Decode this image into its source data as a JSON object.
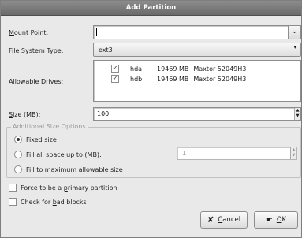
{
  "dialog": {
    "title": "Add Partition"
  },
  "mount_point": {
    "label_pre": "",
    "label_key": "M",
    "label_post": "ount Point:",
    "value": ""
  },
  "fs_type": {
    "label_pre": "File System ",
    "label_key": "T",
    "label_post": "ype:",
    "value": "ext3"
  },
  "drives": {
    "label": "Allowable Drives:",
    "items": [
      {
        "checked": true,
        "name": "hda",
        "size": "19469 MB",
        "model": "Maxtor 52049H3"
      },
      {
        "checked": true,
        "name": "hdb",
        "size": "19469 MB",
        "model": "Maxtor 52049H3"
      }
    ]
  },
  "size": {
    "label_key": "S",
    "label_post": "ize (MB):",
    "value": "100"
  },
  "options": {
    "heading": "Additional Size Options",
    "fixed": {
      "key": "F",
      "rest": "ixed size",
      "selected": true
    },
    "fill_upto": {
      "pre": "Fill all space ",
      "key": "u",
      "post": "p to (MB):",
      "value": "1",
      "selected": false
    },
    "fill_max": {
      "pre": "Fill to maximum ",
      "key": "a",
      "post": "llowable size",
      "selected": false
    }
  },
  "force_primary": {
    "pre": "Force to be a ",
    "key": "p",
    "post": "rimary partition",
    "checked": false
  },
  "check_bad": {
    "pre": "Check for ",
    "key": "b",
    "post": "ad blocks",
    "checked": false
  },
  "buttons": {
    "cancel": {
      "key": "C",
      "rest": "ancel"
    },
    "ok": {
      "key": "O",
      "rest": "K"
    }
  },
  "icons": {
    "cancel": "cancel-x-icon",
    "ok": "ok-hand-icon",
    "dropdown": "chevron-down-icon",
    "check": "checkmark-icon"
  }
}
